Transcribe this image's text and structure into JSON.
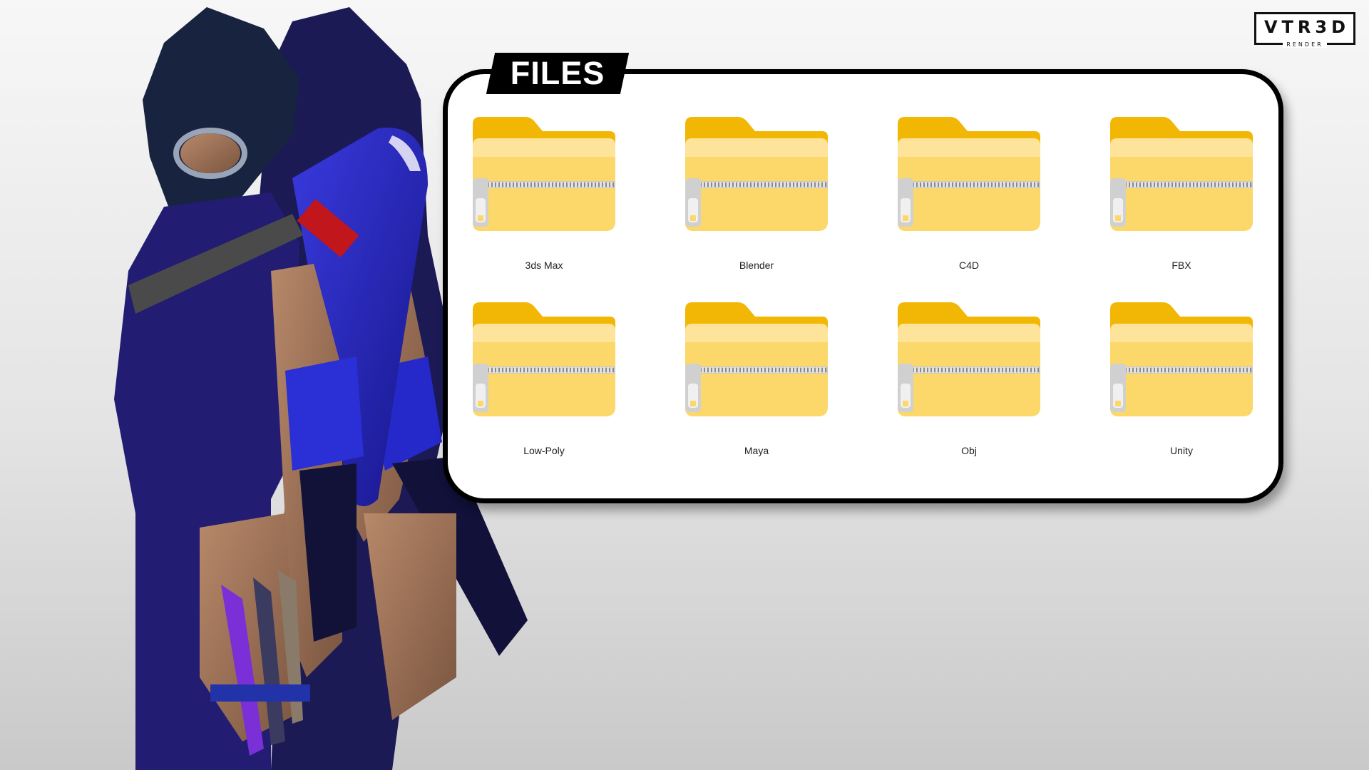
{
  "logo": {
    "main": "VTR3D",
    "sub": "RENDER"
  },
  "panel": {
    "title": "FILES"
  },
  "files": [
    {
      "label": "3ds Max",
      "icon": "zip-folder-icon"
    },
    {
      "label": "Blender",
      "icon": "zip-folder-icon"
    },
    {
      "label": "C4D",
      "icon": "zip-folder-icon"
    },
    {
      "label": "FBX",
      "icon": "zip-folder-icon"
    },
    {
      "label": "Low-Poly",
      "icon": "zip-folder-icon"
    },
    {
      "label": "Maya",
      "icon": "zip-folder-icon"
    },
    {
      "label": "Obj",
      "icon": "zip-folder-icon"
    },
    {
      "label": "Unity",
      "icon": "zip-folder-icon"
    }
  ],
  "colors": {
    "folder_back": "#f2b705",
    "folder_front": "#fcd86a",
    "zipper": "#b8b8b8",
    "panel_border": "#000000",
    "suit": "#1f1b6e",
    "accent_blue": "#2a2fd6"
  }
}
